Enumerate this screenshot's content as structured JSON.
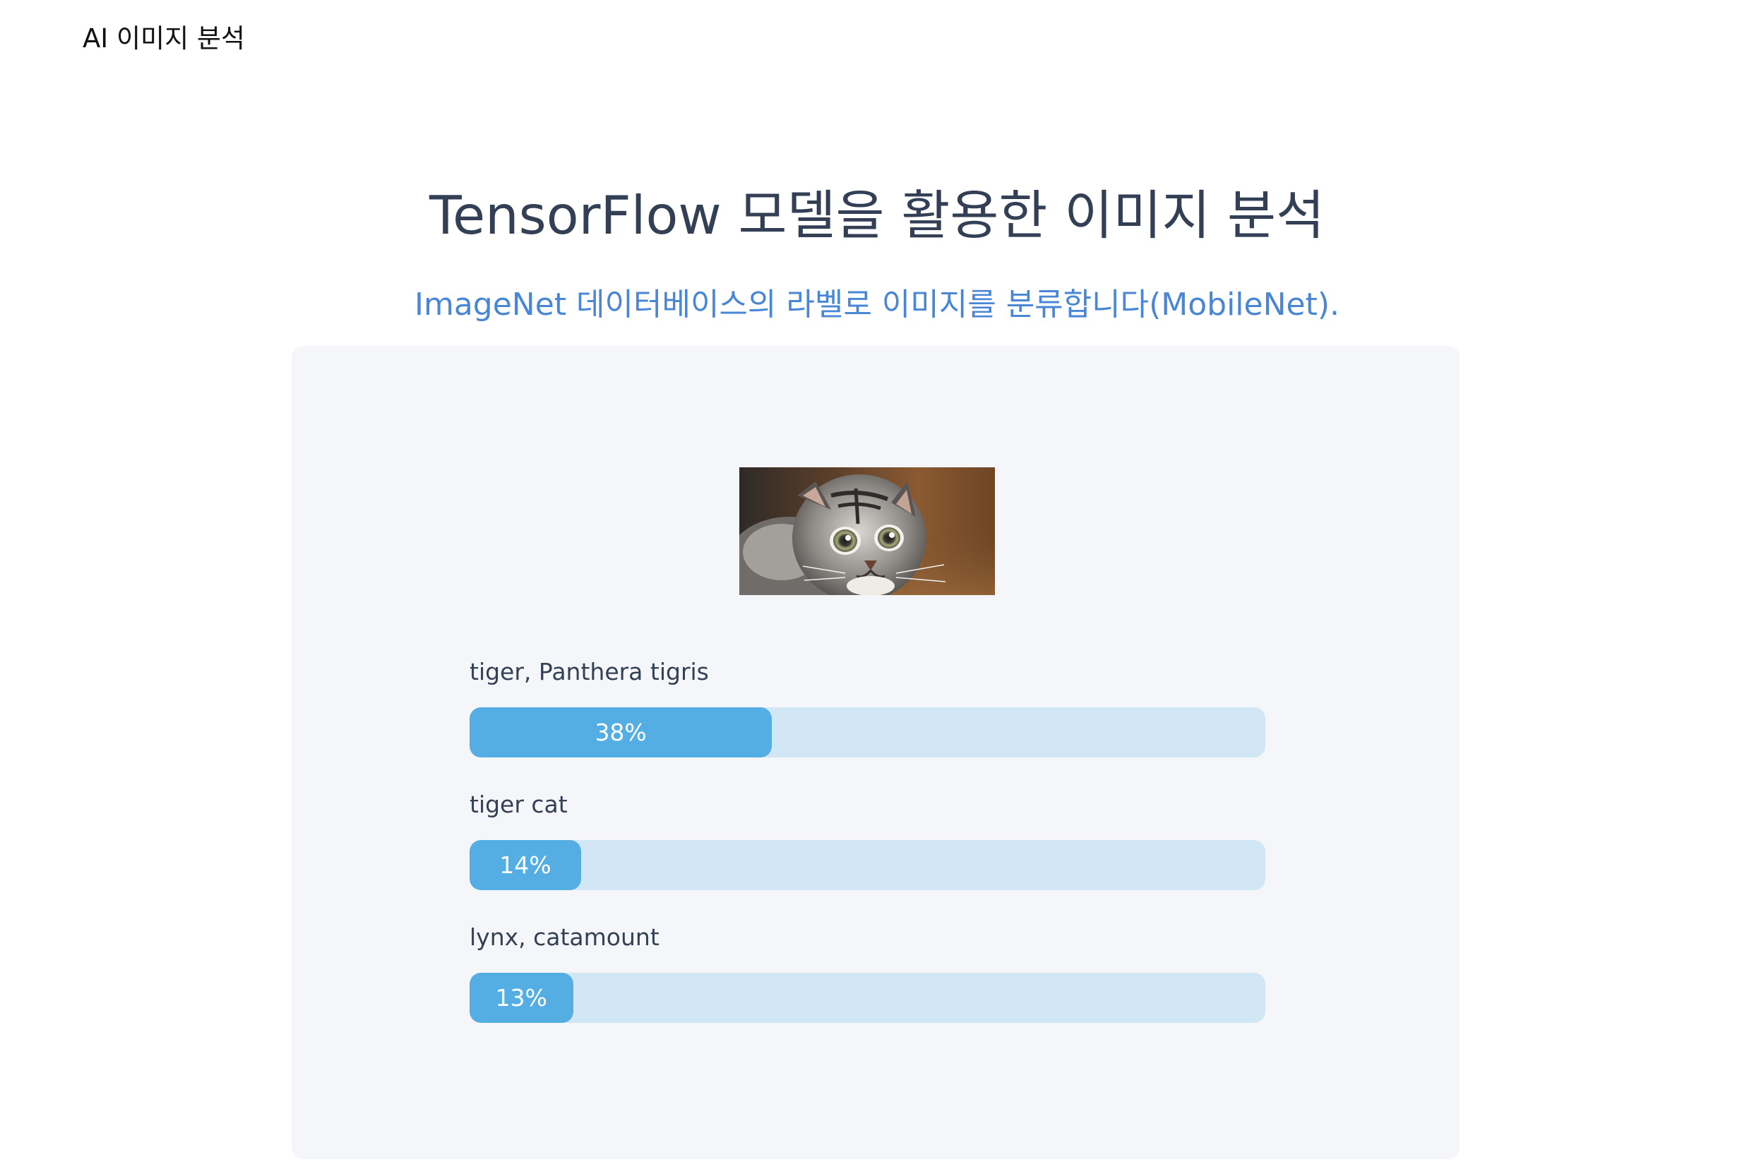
{
  "nav": {
    "brand": "AI 이미지 분석"
  },
  "header": {
    "title": "TensorFlow 모델을 활용한 이미지 분석",
    "subtitle": "ImageNet 데이터베이스의 라벨로 이미지를 분류합니다(MobileNet)."
  },
  "colors": {
    "title": "#333f55",
    "subtitle": "#4a86d6",
    "panel": "#f5f6f9",
    "bar_track": "#d2e7f6",
    "bar_fill": "#54ade3"
  },
  "results": [
    {
      "label": "tiger, Panthera tigris",
      "percent": 38,
      "percent_text": "38%"
    },
    {
      "label": "tiger cat",
      "percent": 14,
      "percent_text": "14%"
    },
    {
      "label": "lynx, catamount",
      "percent": 13,
      "percent_text": "13%"
    }
  ]
}
